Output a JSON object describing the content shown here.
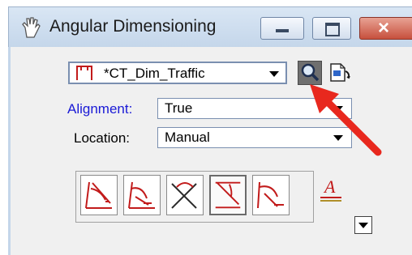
{
  "window": {
    "title": "Angular Dimensioning",
    "icon": "hand-tool-icon",
    "minimize_icon": "minimize-icon",
    "maximize_icon": "maximize-icon",
    "close_icon": "close-icon"
  },
  "dim_style": {
    "value": "*CT_Dim_Traffic",
    "icon": "dimension-style-icon",
    "search_icon": "magnifier-icon",
    "doc_icon": "document-settings-icon"
  },
  "alignment": {
    "label": "Alignment:",
    "value": "True"
  },
  "location": {
    "label": "Location:",
    "value": "Manual"
  },
  "tools": [
    {
      "name": "dimension-angle-size-icon",
      "active": false
    },
    {
      "name": "dimension-angle-location-icon",
      "active": false
    },
    {
      "name": "dimension-angle-lines-icon",
      "active": false
    },
    {
      "name": "dimension-angle-from-x-icon",
      "active": true
    },
    {
      "name": "dimension-angle-from-y-icon",
      "active": false
    }
  ],
  "text_tool_icon": "text-letter-a-icon",
  "expand_icon": "expand-arrow-icon",
  "colors": {
    "accent_red": "#c21b1b",
    "annotation_arrow": "#e8281e",
    "link_blue": "#1a1ad6",
    "titlebar": "#c4d6ea"
  }
}
